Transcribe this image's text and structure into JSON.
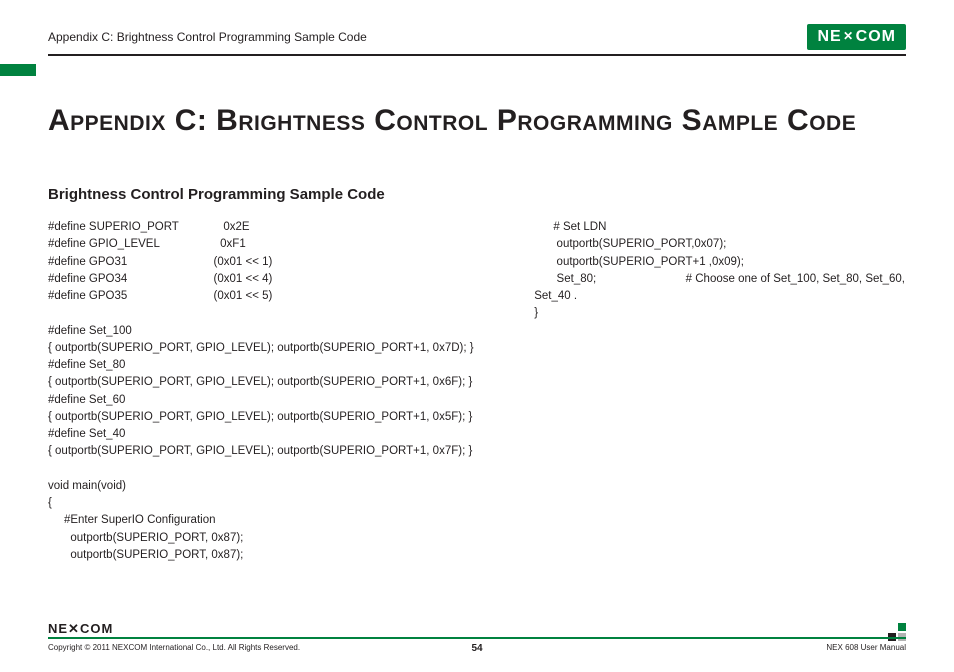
{
  "header": {
    "breadcrumb": "Appendix C: Brightness Control Programming Sample Code",
    "logo_left": "NE",
    "logo_right": "COM"
  },
  "title": "Appendix C: Brightness Control Programming Sample Code",
  "section_title": "Brightness Control Programming Sample Code",
  "code_left": "#define SUPERIO_PORT              0x2E\n#define GPIO_LEVEL                   0xF1\n#define GPO31                           (0x01 << 1)\n#define GPO34                           (0x01 << 4)\n#define GPO35                           (0x01 << 5)\n\n#define Set_100\n{ outportb(SUPERIO_PORT, GPIO_LEVEL); outportb(SUPERIO_PORT+1, 0x7D); }\n#define Set_80\n{ outportb(SUPERIO_PORT, GPIO_LEVEL); outportb(SUPERIO_PORT+1, 0x6F); }\n#define Set_60\n{ outportb(SUPERIO_PORT, GPIO_LEVEL); outportb(SUPERIO_PORT+1, 0x5F); }\n#define Set_40\n{ outportb(SUPERIO_PORT, GPIO_LEVEL); outportb(SUPERIO_PORT+1, 0x7F); }\n\nvoid main(void)\n{\n     #Enter SuperIO Configuration\n       outportb(SUPERIO_PORT, 0x87);\n       outportb(SUPERIO_PORT, 0x87);",
  "code_right": "      # Set LDN\n       outportb(SUPERIO_PORT,0x07);\n       outportb(SUPERIO_PORT+1 ,0x09);\n       Set_80;                            # Choose one of Set_100, Set_80, Set_60,\nSet_40 .\n}",
  "footer": {
    "logo": "NE✕COM",
    "copyright": "Copyright © 2011 NEXCOM International Co., Ltd. All Rights Reserved.",
    "page": "54",
    "manual": "NEX 608 User Manual"
  }
}
